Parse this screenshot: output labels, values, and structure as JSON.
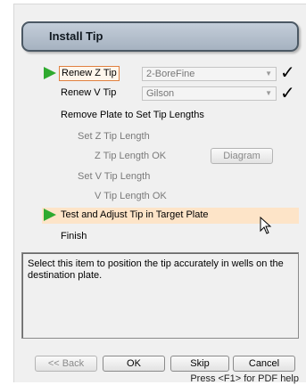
{
  "header": {
    "title": "Install Tip"
  },
  "steps": [
    {
      "label": "Renew Z Tip"
    },
    {
      "label": "Renew V Tip"
    },
    {
      "label": "Remove Plate to Set Tip Lengths"
    },
    {
      "label": "Set Z Tip Length"
    },
    {
      "label": "Z Tip Length OK"
    },
    {
      "label": "Set V Tip Length"
    },
    {
      "label": "V Tip Length OK"
    },
    {
      "label": "Test and Adjust Tip in Target Plate"
    },
    {
      "label": "Finish"
    }
  ],
  "combos": {
    "z_tip": {
      "value": "2-BoreFine"
    },
    "v_tip": {
      "value": "Gilson"
    }
  },
  "buttons": {
    "diagram": "Diagram",
    "back": "<< Back",
    "ok": "OK",
    "skip": "Skip",
    "cancel": "Cancel"
  },
  "description": "Select this item to position the tip accurately in wells on the destination plate.",
  "hint": "Press <F1> for PDF help",
  "colors": {
    "header_border": "#4b5864",
    "active_arrow": "#2faa2f",
    "selected_row": "#fde4c8",
    "current_step_border": "#e08040"
  }
}
